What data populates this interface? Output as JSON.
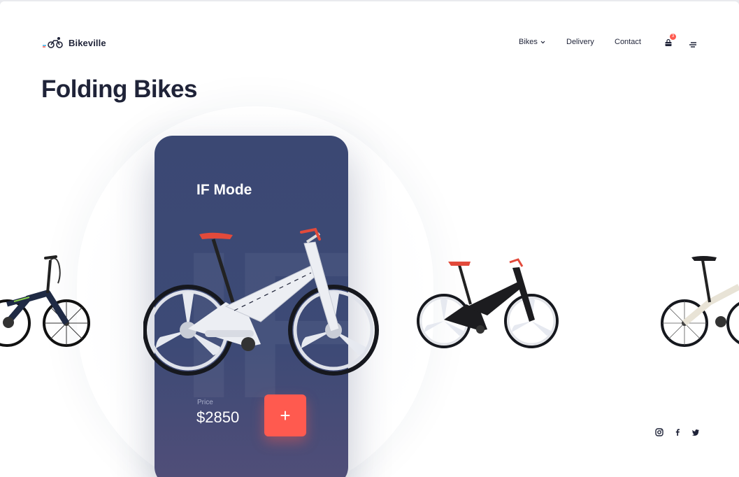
{
  "brand": {
    "name": "Bikeville"
  },
  "nav": {
    "items": [
      {
        "label": "Bikes"
      },
      {
        "label": "Delivery"
      },
      {
        "label": "Contact"
      }
    ],
    "cart_count": "3"
  },
  "page": {
    "title": "Folding Bikes"
  },
  "featured": {
    "name": "IF Mode",
    "watermark": "IF",
    "price_label": "Price",
    "price": "$2850",
    "add_label": "+"
  },
  "bikes": [
    {
      "name": "dark-blue-folding-bike",
      "color": "#1f2a44",
      "accent": "#8ad14f"
    },
    {
      "name": "white-if-mode-bike",
      "color": "#e9ebf1",
      "accent": "#e24a3b"
    },
    {
      "name": "black-if-mode-bike",
      "color": "#1c1c1f",
      "accent": "#e24a3b"
    },
    {
      "name": "cream-folding-bike",
      "color": "#e8e3d6",
      "accent": "#1c1c1f"
    }
  ],
  "social": [
    "instagram-icon",
    "facebook-icon",
    "twitter-icon"
  ],
  "colors": {
    "accent": "#ff5a4f",
    "card": "#3d4a76",
    "text": "#1f2338"
  }
}
